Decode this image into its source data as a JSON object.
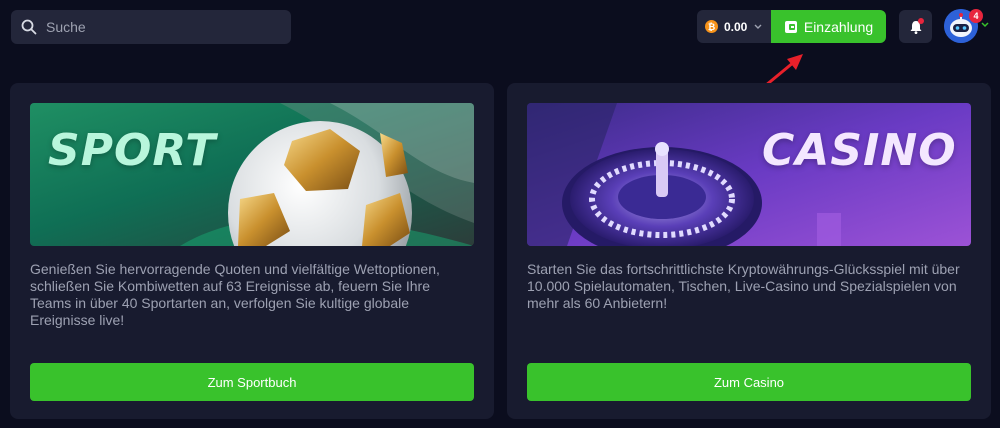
{
  "header": {
    "search": {
      "placeholder": "Suche",
      "icon": "search-icon"
    },
    "wallet": {
      "amount": "0.00",
      "currency_icon": "bitcoin-icon",
      "currency_symbol": "₿"
    },
    "deposit": {
      "label": "Einzahlung",
      "icon": "wallet-icon"
    },
    "notifications": {
      "icon": "bell-icon"
    },
    "profile": {
      "badge_count": "4",
      "icon": "robot-avatar-icon"
    }
  },
  "cards": [
    {
      "banner_title": "SPORT",
      "description": "Genießen Sie hervorragende Quoten und vielfältige Wettoptionen, schließen Sie Kombiwetten auf 63 Ereignisse ab, feuern Sie Ihre Teams in über 40 Sportarten an, verfolgen Sie kultige globale Ereignisse live!",
      "button_label": "Zum Sportbuch"
    },
    {
      "banner_title": "CASINO",
      "description": "Starten Sie das fortschrittlichste Kryptowährungs-Glücksspiel mit über 10.000 Spielautomaten, Tischen, Live-Casino und Spezialspielen von mehr als 60 Anbietern!",
      "button_label": "Zum Casino"
    }
  ],
  "colors": {
    "background": "#0b0d1e",
    "card": "#181b2f",
    "accent_green": "#39c22c",
    "input_bg": "#23263a",
    "alert_red": "#e8253d"
  }
}
